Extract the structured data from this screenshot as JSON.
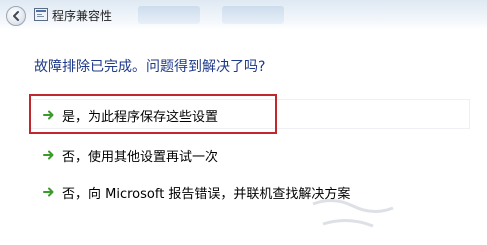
{
  "window": {
    "title": "程序兼容性"
  },
  "content": {
    "question": "故障排除已完成。问题得到解决了吗?",
    "options": [
      {
        "label": "是，为此程序保存这些设置",
        "icon": "green-arrow-icon",
        "highlighted": true
      },
      {
        "label": "否，使用其他设置再试一次",
        "icon": "green-arrow-icon",
        "highlighted": false
      },
      {
        "label": "否，向 Microsoft 报告错误，并联机查找解决方案",
        "icon": "green-arrow-icon",
        "highlighted": false
      }
    ]
  },
  "colors": {
    "question_text": "#1f3a8a",
    "arrow": "#3a9a2a",
    "highlight_border": "#c1272d"
  }
}
